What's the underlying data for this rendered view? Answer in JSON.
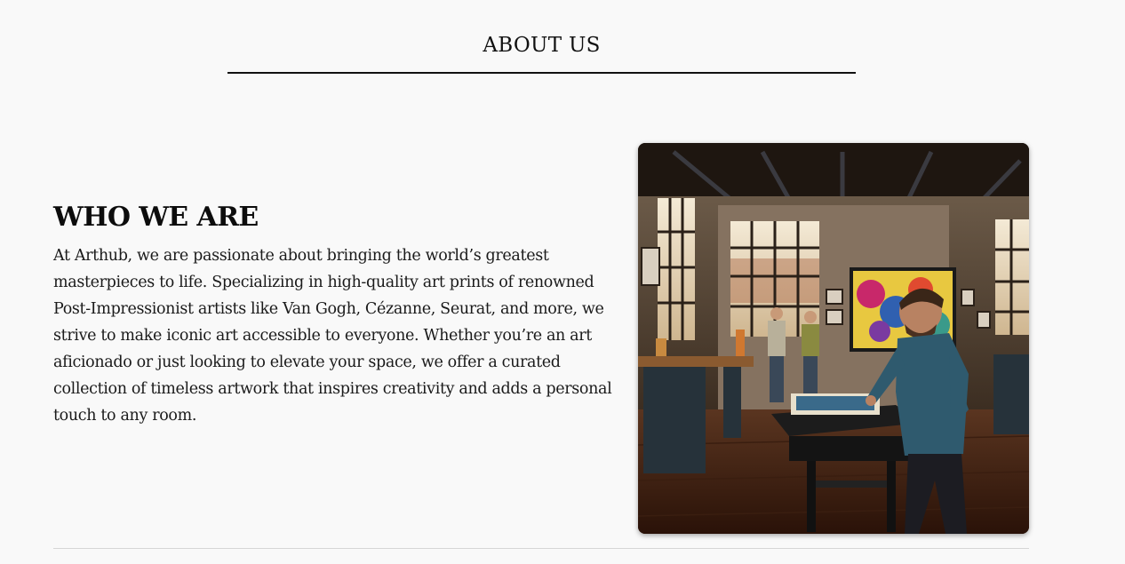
{
  "header": {
    "title": "ABOUT US"
  },
  "about": {
    "heading": "WHO WE ARE",
    "body": "At Arthub, we are passionate about bringing the world’s greatest masterpieces to life. Specializing in high-quality art prints of renowned Post-Impressionist artists like Van Gogh, Cézanne, Seurat, and more, we strive to make iconic art accessible to everyone. Whether you’re an art aficionado or just looking to elevate your space, we offer a curated collection of timeless artwork that inspires creativity and adds a personal touch to any room."
  },
  "colors": {
    "background": "#f9f9f9",
    "text": "#111111",
    "divider": "#d6d6d6"
  }
}
